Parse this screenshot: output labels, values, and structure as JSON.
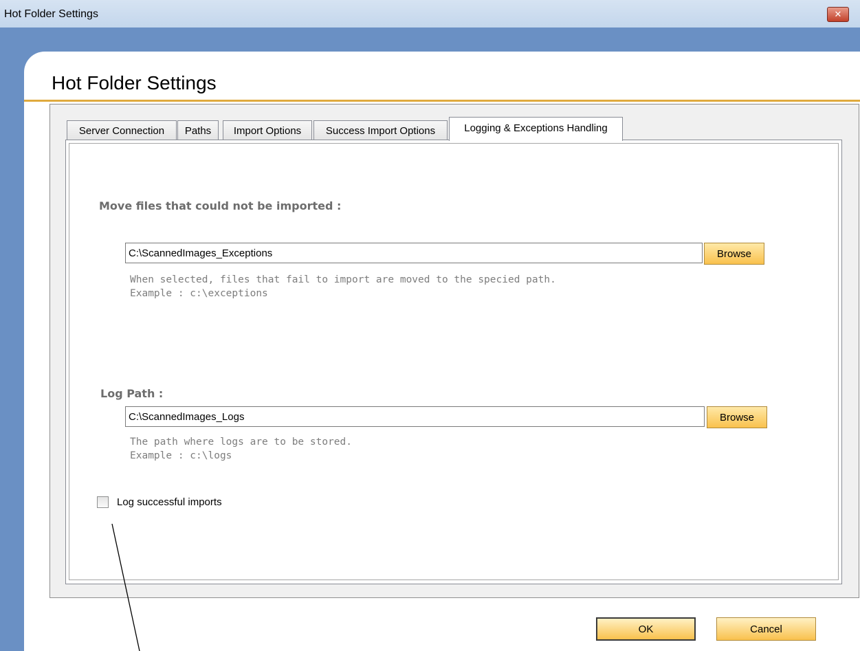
{
  "window": {
    "title": "Hot Folder Settings",
    "close_glyph": "✕"
  },
  "header": {
    "title": "Hot Folder Settings"
  },
  "tabs": [
    {
      "label": "Server Connection",
      "active": false
    },
    {
      "label": "Paths",
      "active": false
    },
    {
      "label": "Import Options",
      "active": false
    },
    {
      "label": "Success Import Options",
      "active": false
    },
    {
      "label": "Logging & Exceptions Handling",
      "active": true
    }
  ],
  "exceptions": {
    "label": "Move files that could not be imported :",
    "path_value": "C:\\ScannedImages_Exceptions",
    "browse_label": "Browse",
    "help_line1": "When selected, files that fail to import are moved to the specied path.",
    "help_line2": "Example : c:\\exceptions"
  },
  "log": {
    "label": "Log Path :",
    "path_value": "C:\\ScannedImages_Logs",
    "browse_label": "Browse",
    "help_line1": "The path where logs are to be stored.",
    "help_line2": "Example : c:\\logs"
  },
  "log_success": {
    "label": "Log successful imports",
    "checked": false
  },
  "buttons": {
    "ok_label": "OK",
    "cancel_label": "Cancel"
  },
  "colors": {
    "frame": "#6a90c4",
    "accent_rule": "#e0aa3e",
    "button_gradient_bottom": "#f9c14d"
  }
}
